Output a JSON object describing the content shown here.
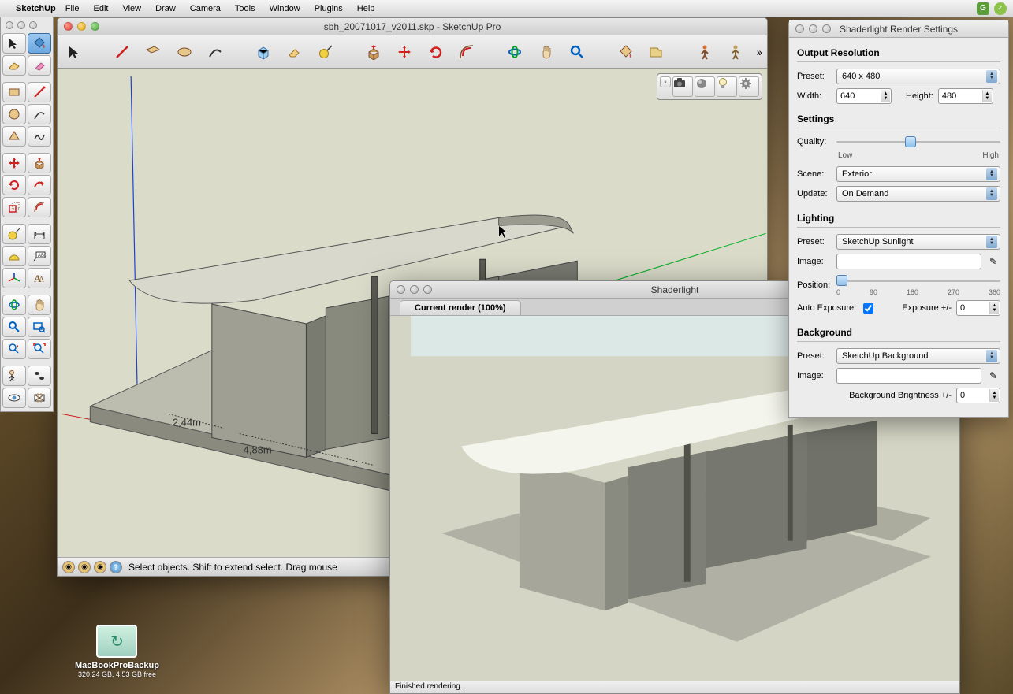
{
  "menubar": {
    "app": "SketchUp",
    "items": [
      "File",
      "Edit",
      "View",
      "Draw",
      "Camera",
      "Tools",
      "Window",
      "Plugins",
      "Help"
    ]
  },
  "doc": {
    "title": "sbh_20071017_v2011.skp - SketchUp Pro",
    "status": "Select objects. Shift to extend select. Drag mouse",
    "dim1": "2,44m",
    "dim2": "4,88m"
  },
  "render": {
    "title": "Shaderlight",
    "tab": "Current render (100%)",
    "status": "Finished rendering."
  },
  "settings": {
    "title": "Shaderlight Render Settings",
    "output": {
      "head": "Output Resolution",
      "preset_lbl": "Preset:",
      "preset": "640 x 480",
      "width_lbl": "Width:",
      "width": "640",
      "height_lbl": "Height:",
      "height": "480"
    },
    "general": {
      "head": "Settings",
      "quality_lbl": "Quality:",
      "low": "Low",
      "high": "High",
      "scene_lbl": "Scene:",
      "scene": "Exterior",
      "update_lbl": "Update:",
      "update": "On Demand"
    },
    "lighting": {
      "head": "Lighting",
      "preset_lbl": "Preset:",
      "preset": "SketchUp Sunlight",
      "image_lbl": "Image:",
      "position_lbl": "Position:",
      "ticks": [
        "0",
        "90",
        "180",
        "270",
        "360"
      ],
      "autoexp_lbl": "Auto Exposure:",
      "exposure_lbl": "Exposure +/-",
      "exposure": "0"
    },
    "bg": {
      "head": "Background",
      "preset_lbl": "Preset:",
      "preset": "SketchUp Background",
      "image_lbl": "Image:",
      "bright_lbl": "Background Brightness +/-",
      "bright": "0"
    }
  },
  "desktop": {
    "name": "MacBookProBackup",
    "sub": "320,24 GB, 4,53 GB free"
  }
}
